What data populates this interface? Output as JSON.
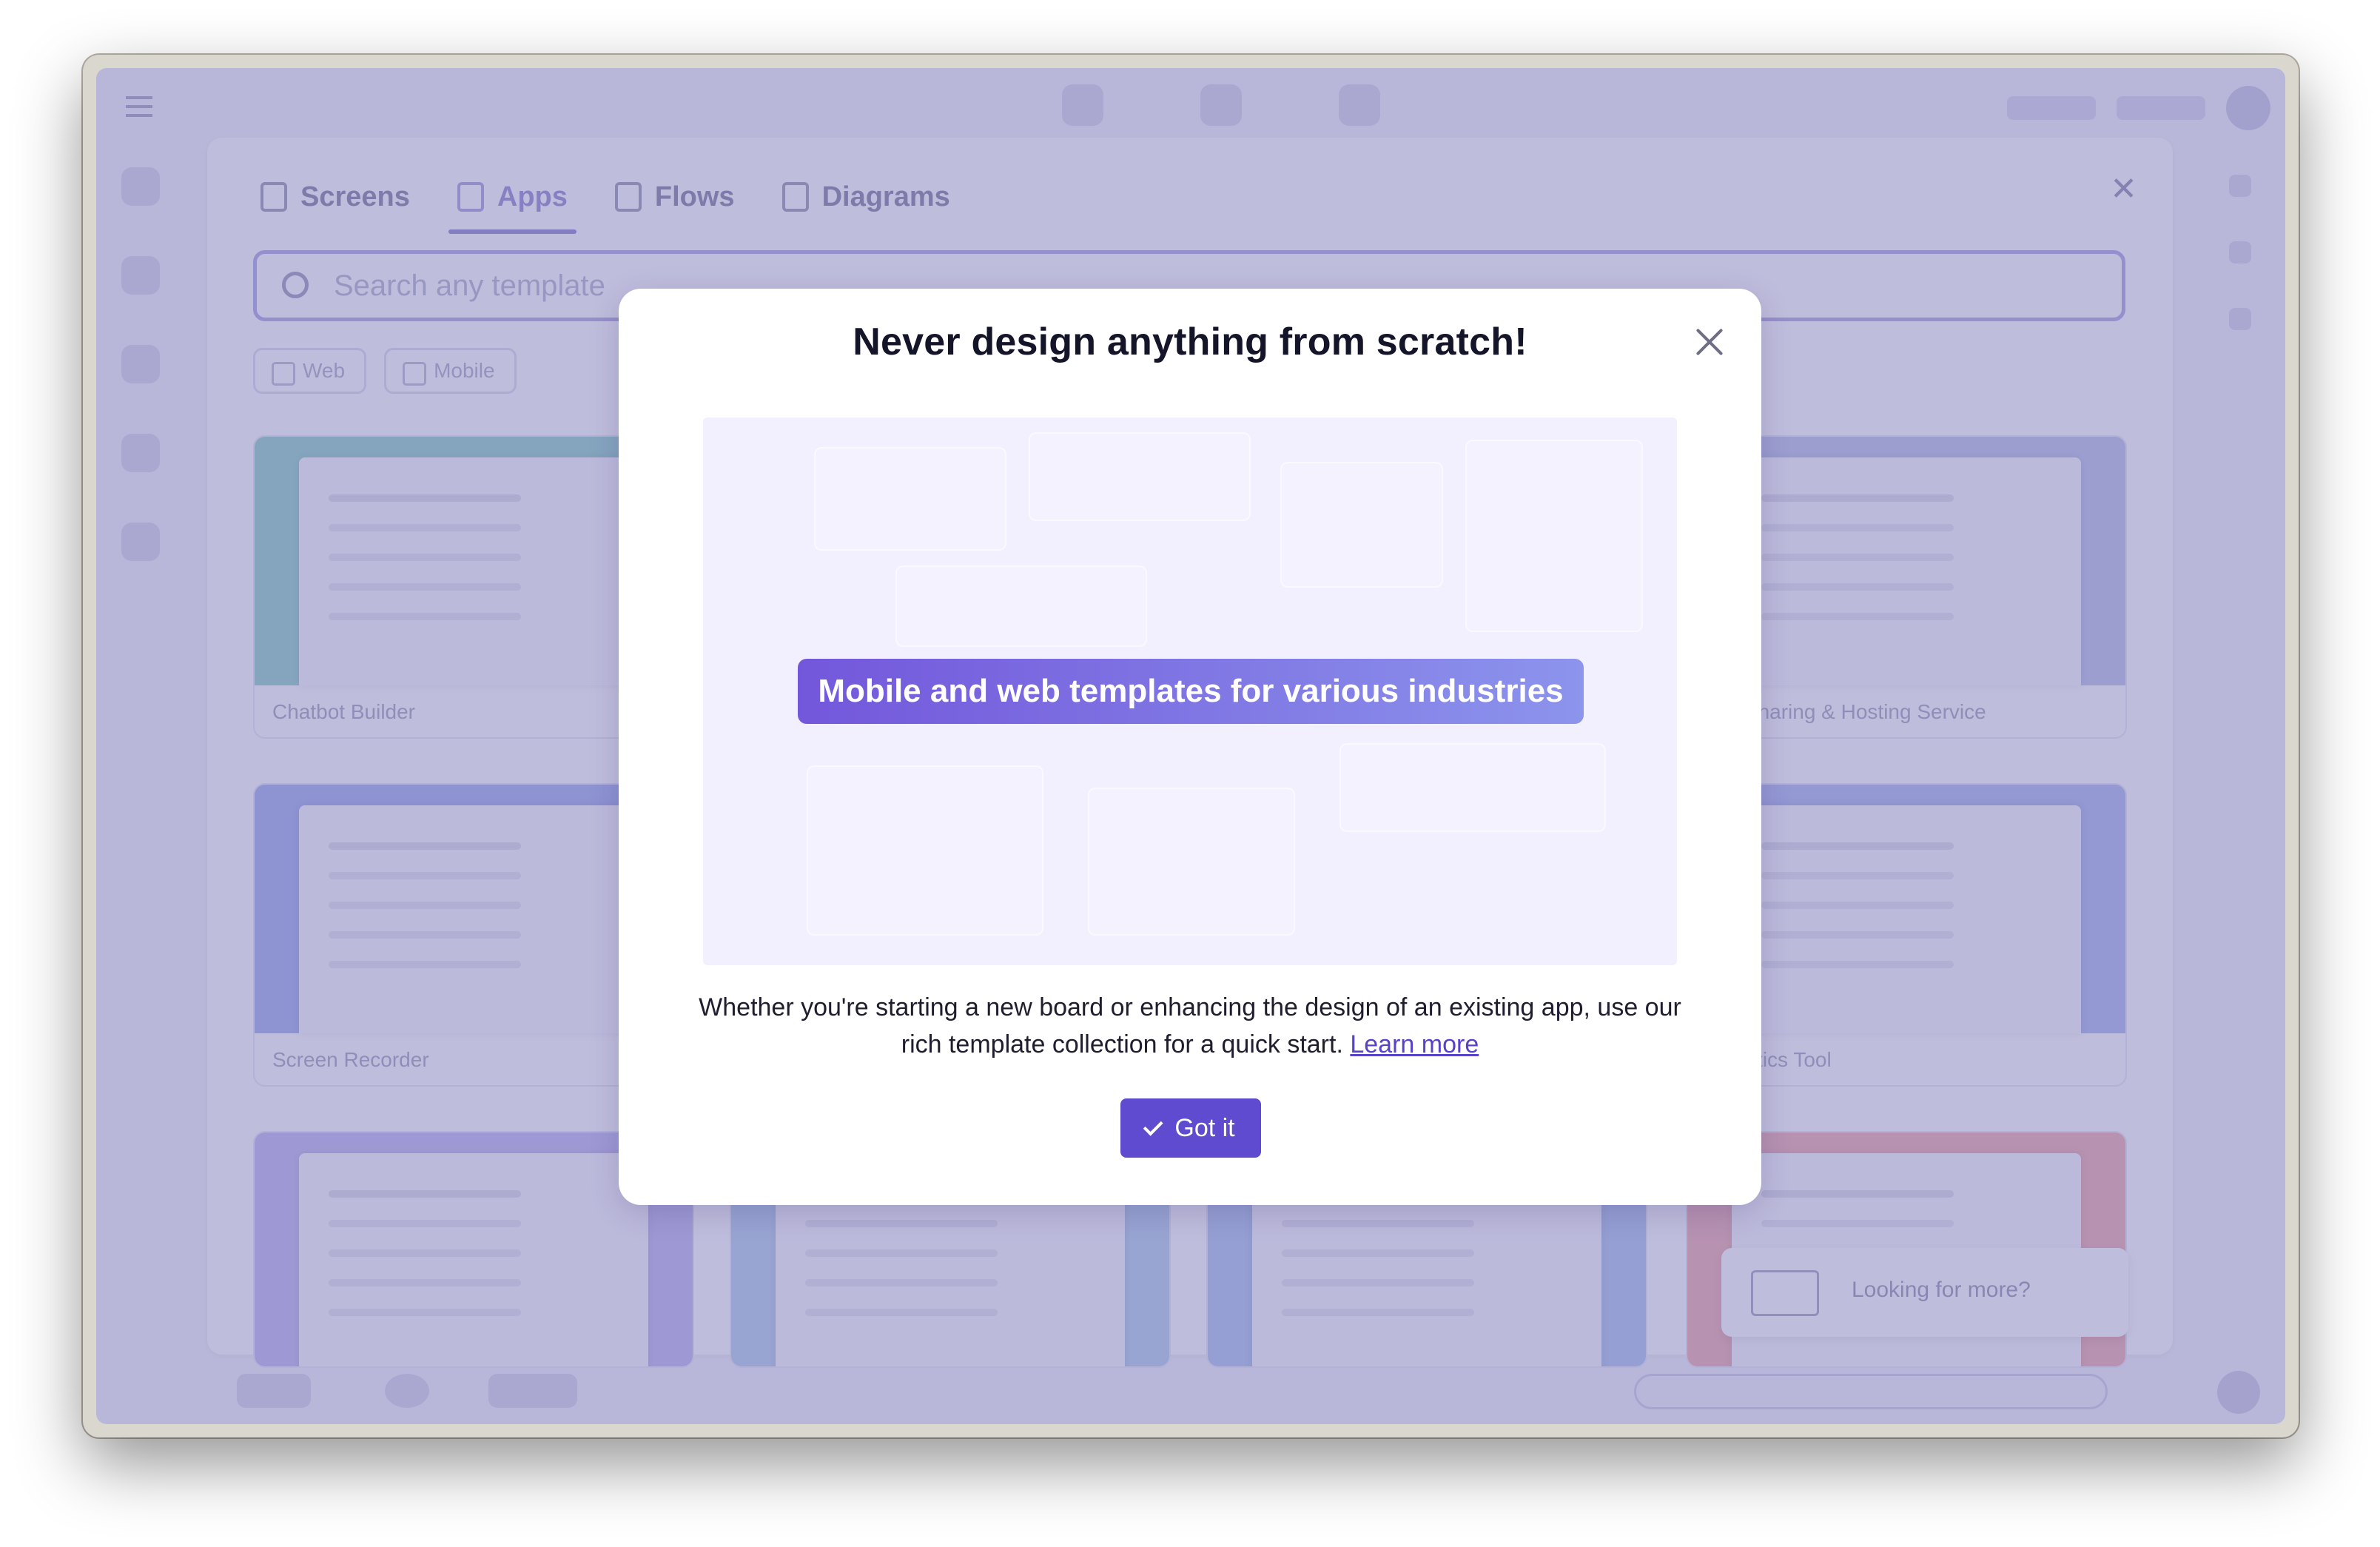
{
  "background": {
    "tabs": [
      {
        "label": "Screens",
        "icon": "screen-icon",
        "active": false
      },
      {
        "label": "Apps",
        "icon": "apps-icon",
        "active": true
      },
      {
        "label": "Flows",
        "icon": "flows-icon",
        "active": false
      },
      {
        "label": "Diagrams",
        "icon": "diagram-icon",
        "active": false
      }
    ],
    "search_placeholder": "Search any template",
    "filters": [
      "Web",
      "Mobile"
    ],
    "cards": [
      {
        "label": "Chatbot Builder",
        "color": "#9fd7cf"
      },
      {
        "label": "File Sharing & Hosting Service",
        "color": "#c6cbec"
      },
      {
        "label": "Screen Recorder",
        "color": "#aeb9ef"
      },
      {
        "label": "Analytics Tool",
        "color": "#b7c1f0"
      },
      {
        "label": "",
        "color": "#c9c3f2"
      },
      {
        "label": "",
        "color": "#bfd6ef"
      },
      {
        "label": "",
        "color": "#b9cdf1"
      },
      {
        "label": "",
        "color": "#f2b8b8"
      }
    ],
    "looking_for_more": "Looking for more?"
  },
  "modal": {
    "title": "Never design anything from scratch!",
    "banner": "Mobile and web templates for various industries",
    "description": "Whether you're starting a new board or enhancing the design of an existing app, use our rich template collection for a quick start.",
    "learn_more": "Learn more",
    "confirm_label": "Got it"
  },
  "colors": {
    "accent": "#5f4bd0",
    "banner_gradient_start": "#7357db",
    "banner_gradient_end": "#8c94ec",
    "preview_bg": "#f2efff",
    "scrim": "rgba(96, 90, 168, 0.40)"
  }
}
